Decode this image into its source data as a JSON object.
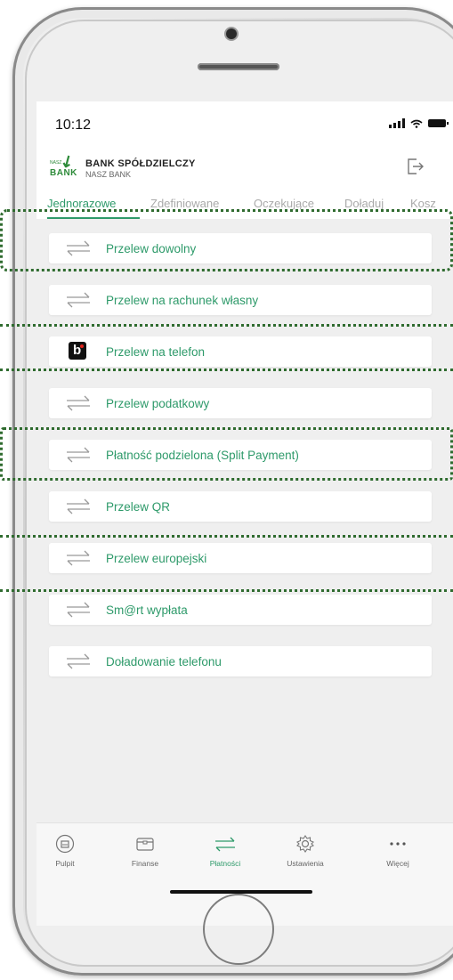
{
  "status_bar": {
    "time": "10:12"
  },
  "header": {
    "logo_small": "NASZ",
    "logo_word": "BANK",
    "bank_name": "BANK SPÓŁDZIELCZY",
    "bank_sub": "NASZ BANK"
  },
  "tabs": [
    {
      "label": "Jednorazowe",
      "active": true
    },
    {
      "label": "Zdefiniowane",
      "active": false
    },
    {
      "label": "Oczekujące",
      "active": false
    },
    {
      "label": "Doładuj",
      "active": false
    },
    {
      "label": "Kosz",
      "active": false
    }
  ],
  "payments": [
    {
      "label": "Przelew dowolny",
      "icon": "transfer-arrows-icon"
    },
    {
      "label": "Przelew na rachunek własny",
      "icon": "transfer-arrows-icon"
    },
    {
      "label": "Przelew na telefon",
      "icon": "blik-icon"
    },
    {
      "label": "Przelew podatkowy",
      "icon": "transfer-arrows-icon"
    },
    {
      "label": "Płatność podzielona (Split Payment)",
      "icon": "transfer-arrows-icon"
    },
    {
      "label": "Przelew QR",
      "icon": "transfer-arrows-icon"
    },
    {
      "label": "Przelew europejski",
      "icon": "transfer-arrows-icon"
    },
    {
      "label": "Sm@rt wypłata",
      "icon": "transfer-arrows-icon"
    },
    {
      "label": "Doładowanie telefonu",
      "icon": "transfer-arrows-icon"
    }
  ],
  "bottom_nav": [
    {
      "label": "Pulpit",
      "icon": "home-icon",
      "active": false
    },
    {
      "label": "Finanse",
      "icon": "wallet-icon",
      "active": false
    },
    {
      "label": "Płatności",
      "icon": "transfer-arrows-icon",
      "active": true
    },
    {
      "label": "Ustawienia",
      "icon": "gear-icon",
      "active": false
    },
    {
      "label": "Więcej",
      "icon": "more-dots-icon",
      "active": false
    }
  ],
  "colors": {
    "accent": "#2e9a6a",
    "highlight": "#2f6b2f",
    "blik_red": "#e2241b"
  }
}
